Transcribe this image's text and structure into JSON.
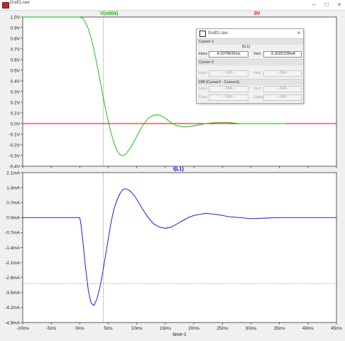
{
  "window": {
    "title": "Draft1.raw",
    "buttons": [
      "minimize-icon",
      "maximize-icon",
      "close-icon"
    ]
  },
  "top_pane": {
    "traces": [
      {
        "label": "V(n004)",
        "color": "#00c000"
      },
      {
        "label": "0V",
        "color": "#ff0000"
      }
    ],
    "y_ticks": [
      "1.0V",
      "0.9V",
      "0.8V",
      "0.7V",
      "0.6V",
      "0.5V",
      "0.4V",
      "0.3V",
      "0.2V",
      "0.1V",
      "0.0V",
      "-0.1V",
      "-0.2V",
      "-0.3V",
      "-0.4V"
    ]
  },
  "bottom_pane": {
    "traces": [
      {
        "label": "I(L1)",
        "color": "#0000ff"
      }
    ],
    "y_ticks": [
      "2.1mA",
      "1.4mA",
      "0.7mA",
      "0.0mA",
      "-0.7mA",
      "-1.4mA",
      "-2.1mA",
      "-2.8mA",
      "-3.5mA",
      "-4.2mA",
      "-4.9mA"
    ]
  },
  "x_axis": {
    "label": "time-1",
    "ticks": [
      "-10ms",
      "-5ms",
      "0ms",
      "5ms",
      "10ms",
      "15ms",
      "20ms",
      "25ms",
      "30ms",
      "35ms",
      "40ms",
      "45ms"
    ]
  },
  "cursor_dialog": {
    "title": "Draft1.raw",
    "cursor1_label": "Cursor 1",
    "trace_name": "I(L1)",
    "horz_label": "Horz:",
    "horz_value": "4.1079632ms",
    "vert_label": "Vert:",
    "vert_value": "-3.1025128mA",
    "cursor2_label": "Cursor 2",
    "c2_horz_label": "Horz:",
    "c2_horz_value": "-- N/A--",
    "c2_vert_label": "Vert:",
    "c2_vert_value": "-- N/A--",
    "diff_label": "Diff (Cursor2 - Cursor1)",
    "diff_horz_label": "Horz:",
    "diff_horz_value": "-- N/A--",
    "diff_vert_label": "Vert:",
    "diff_vert_value": "-- N/A--",
    "freq_label": "Freq:",
    "freq_value": "-- N/A--",
    "slope_label": "Slope:",
    "slope_value": "-- N/A--"
  },
  "chart_data": [
    {
      "type": "line",
      "title": "V(n004)",
      "xlabel": "time-1",
      "ylabel": "",
      "xlim": [
        -10,
        45
      ],
      "ylim": [
        -0.4,
        1.0
      ],
      "x_units": "ms",
      "y_units": "V",
      "series": [
        {
          "name": "V(n004)",
          "color": "#00c000",
          "x": [
            -10,
            -5,
            0,
            0.5,
            1,
            1.5,
            2,
            2.5,
            3,
            3.5,
            4,
            4.5,
            5,
            5.5,
            6,
            6.5,
            7,
            7.5,
            8,
            9,
            10,
            11,
            12,
            13,
            14,
            15,
            16,
            17,
            18,
            19,
            20,
            21,
            22,
            24,
            26,
            28,
            30,
            33,
            36
          ],
          "y": [
            1.0,
            1.0,
            1.0,
            0.99,
            0.95,
            0.89,
            0.8,
            0.69,
            0.56,
            0.42,
            0.28,
            0.14,
            0.02,
            -0.09,
            -0.18,
            -0.25,
            -0.29,
            -0.3,
            -0.29,
            -0.22,
            -0.12,
            -0.02,
            0.05,
            0.08,
            0.08,
            0.05,
            0.01,
            -0.02,
            -0.03,
            -0.03,
            -0.02,
            -0.01,
            0.0,
            0.01,
            0.01,
            0.0,
            0.0,
            0.0,
            0.0
          ]
        },
        {
          "name": "0V",
          "color": "#ff0000",
          "x": [
            -10,
            45
          ],
          "y": [
            0,
            0
          ]
        }
      ],
      "cursor": {
        "x": 4.1
      }
    },
    {
      "type": "line",
      "title": "I(L1)",
      "xlabel": "time-1",
      "ylabel": "",
      "xlim": [
        -10,
        45
      ],
      "ylim": [
        -4.9,
        2.1
      ],
      "x_units": "ms",
      "y_units": "mA",
      "series": [
        {
          "name": "I(L1)",
          "color": "#0000ff",
          "x": [
            -10,
            -5,
            0,
            0.2,
            0.5,
            1,
            1.5,
            2,
            2.5,
            3,
            3.5,
            4,
            4.5,
            5,
            5.5,
            6,
            6.5,
            7,
            7.5,
            8,
            8.5,
            9,
            9.5,
            10,
            11,
            12,
            13,
            14,
            15,
            16,
            17,
            18,
            19,
            20,
            22,
            24,
            26,
            28,
            30,
            35,
            40,
            45
          ],
          "y": [
            0,
            0,
            0,
            -0.3,
            -1.0,
            -2.3,
            -3.4,
            -4.0,
            -4.1,
            -3.8,
            -3.3,
            -2.6,
            -1.8,
            -1.0,
            -0.2,
            0.4,
            0.8,
            1.1,
            1.3,
            1.35,
            1.3,
            1.2,
            1.05,
            0.85,
            0.4,
            0.0,
            -0.3,
            -0.45,
            -0.5,
            -0.45,
            -0.3,
            -0.15,
            0.0,
            0.1,
            0.2,
            0.15,
            0.05,
            0.0,
            -0.05,
            0.0,
            0.0,
            0.0
          ]
        }
      ],
      "cursor": {
        "x": 4.1,
        "y": -3.1
      }
    }
  ]
}
